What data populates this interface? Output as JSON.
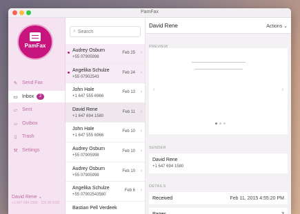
{
  "window": {
    "title": "PamFax"
  },
  "sidebar": {
    "logo_text": "PamFax",
    "items": [
      {
        "label": "Send Fax",
        "icon": "edit-icon"
      },
      {
        "label": "Inbox",
        "icon": "tray-icon",
        "badge": "2",
        "active": true
      },
      {
        "label": "Sent",
        "icon": "folder-icon"
      },
      {
        "label": "Outbox",
        "icon": "folder-icon"
      },
      {
        "label": "Trash",
        "icon": "trash-icon"
      },
      {
        "label": "Settings",
        "icon": "wrench-icon"
      }
    ],
    "account_name": "David Rene ⌄",
    "account_sub": "+1 647 694 1580 · 100.00 USD"
  },
  "list": {
    "search_placeholder": "Search",
    "items": [
      {
        "name": "Audrey Osburn",
        "number": "+55 07905998",
        "date": "Feb 25",
        "unread": true
      },
      {
        "name": "Angelika Schulze",
        "number": "+55 07902543",
        "date": "Feb 24",
        "unread": true
      },
      {
        "name": "John Hale",
        "number": "+1 647 555 6966",
        "date": "Feb 13",
        "unread": false
      },
      {
        "name": "David Rene",
        "number": "+1 647 694 1580",
        "date": "Feb 11",
        "unread": false,
        "selected": true
      },
      {
        "name": "John Hale",
        "number": "+1 647 555 6966",
        "date": "Feb 10",
        "unread": false
      },
      {
        "name": "Audrey Osburn",
        "number": "+55 07905998",
        "date": "Feb 10",
        "unread": false
      },
      {
        "name": "Audrey Osburn",
        "number": "+55 07905998",
        "date": "Feb 10",
        "unread": false
      },
      {
        "name": "Angelika Schulze",
        "number": "+55 07902543580",
        "date": "Feb 6",
        "unread": false
      },
      {
        "name": "Bastian Pell Verdeek",
        "number": "",
        "date": "",
        "unread": false
      }
    ]
  },
  "detail": {
    "title": "David Rene",
    "actions_label": "Actions ⌄",
    "preview_label": "PREVIEW",
    "sender_label": "SENDER",
    "sender_name": "David Rene",
    "sender_number": "+1 647 694 1580",
    "details_label": "DETAILS",
    "rows": [
      {
        "key": "Received",
        "value": "Feb 11, 2015 4:55:20 PM"
      },
      {
        "key": "Pages",
        "value": "3"
      }
    ]
  },
  "colors": {
    "accent": "#c8157e",
    "sidebar_bg": "#f6e3f1"
  }
}
